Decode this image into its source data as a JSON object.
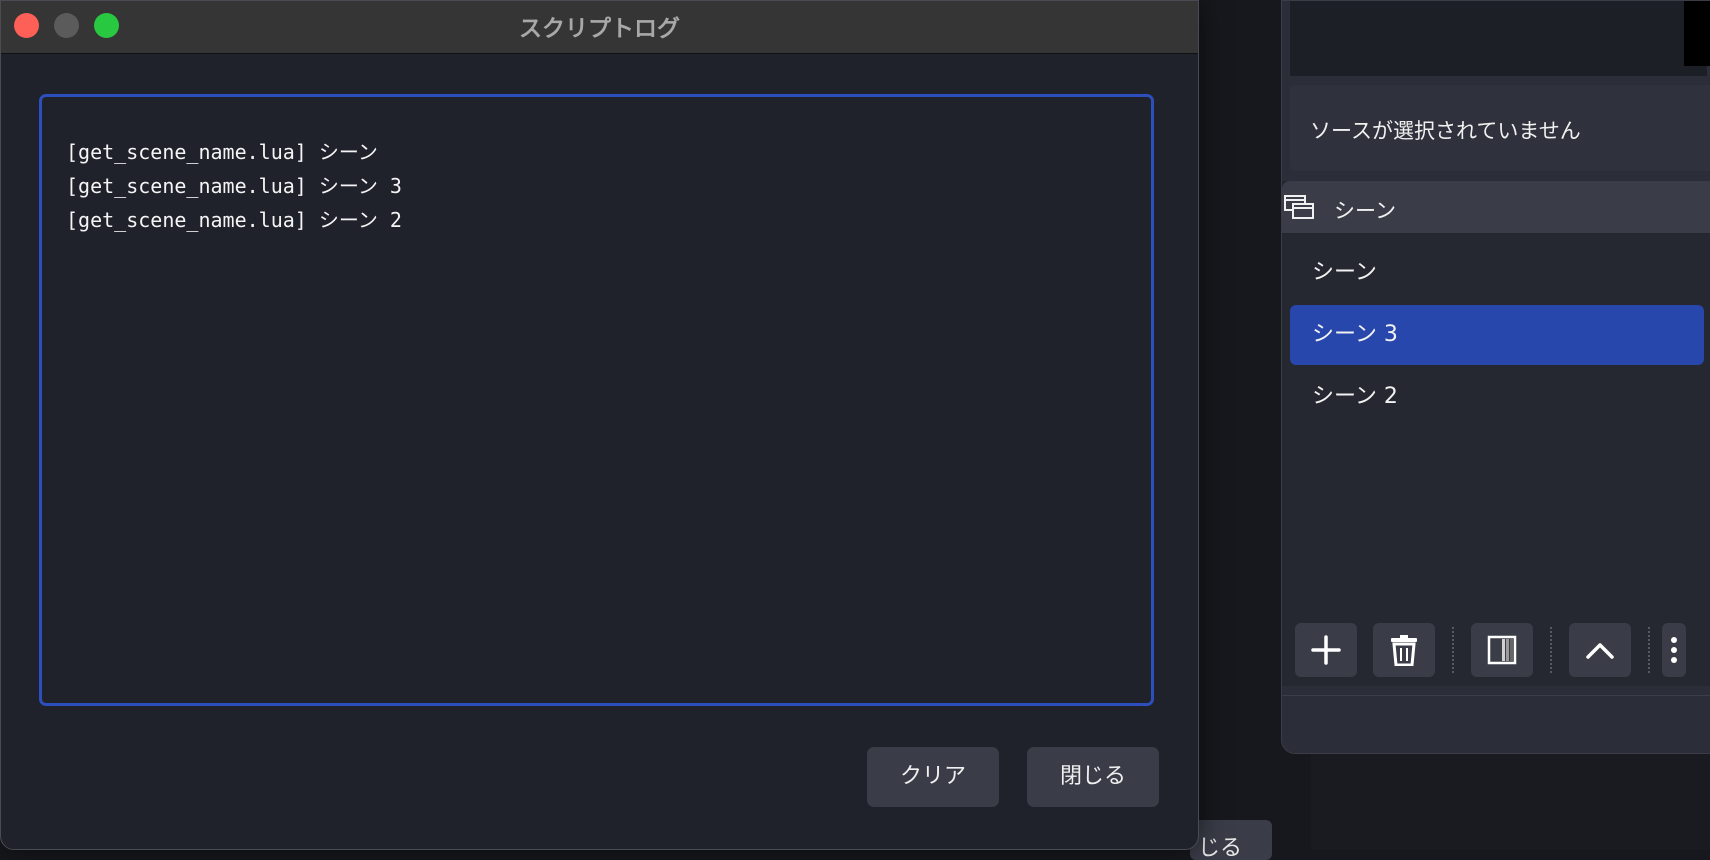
{
  "dialog": {
    "title": "スクリプトログ",
    "log_lines": [
      "[get_scene_name.lua] シーン",
      "[get_scene_name.lua] シーン 3",
      "[get_scene_name.lua] シーン 2"
    ],
    "clear_label": "クリア",
    "close_label": "閉じる"
  },
  "main": {
    "no_source_text": "ソースが選択されていません",
    "scenes_title": "シーン",
    "scenes": [
      {
        "label": "シーン",
        "selected": false
      },
      {
        "label": "シーン 3",
        "selected": true
      },
      {
        "label": "シーン 2",
        "selected": false
      }
    ],
    "toolbar_icons": [
      "add-icon",
      "trash-icon",
      "filter-icon",
      "chevron-up-icon",
      "more-vertical-icon"
    ],
    "bg_button_partial": "じる"
  },
  "colors": {
    "accent": "#2847ad",
    "traffic_close": "#fe5f57",
    "traffic_max": "#28c840"
  }
}
